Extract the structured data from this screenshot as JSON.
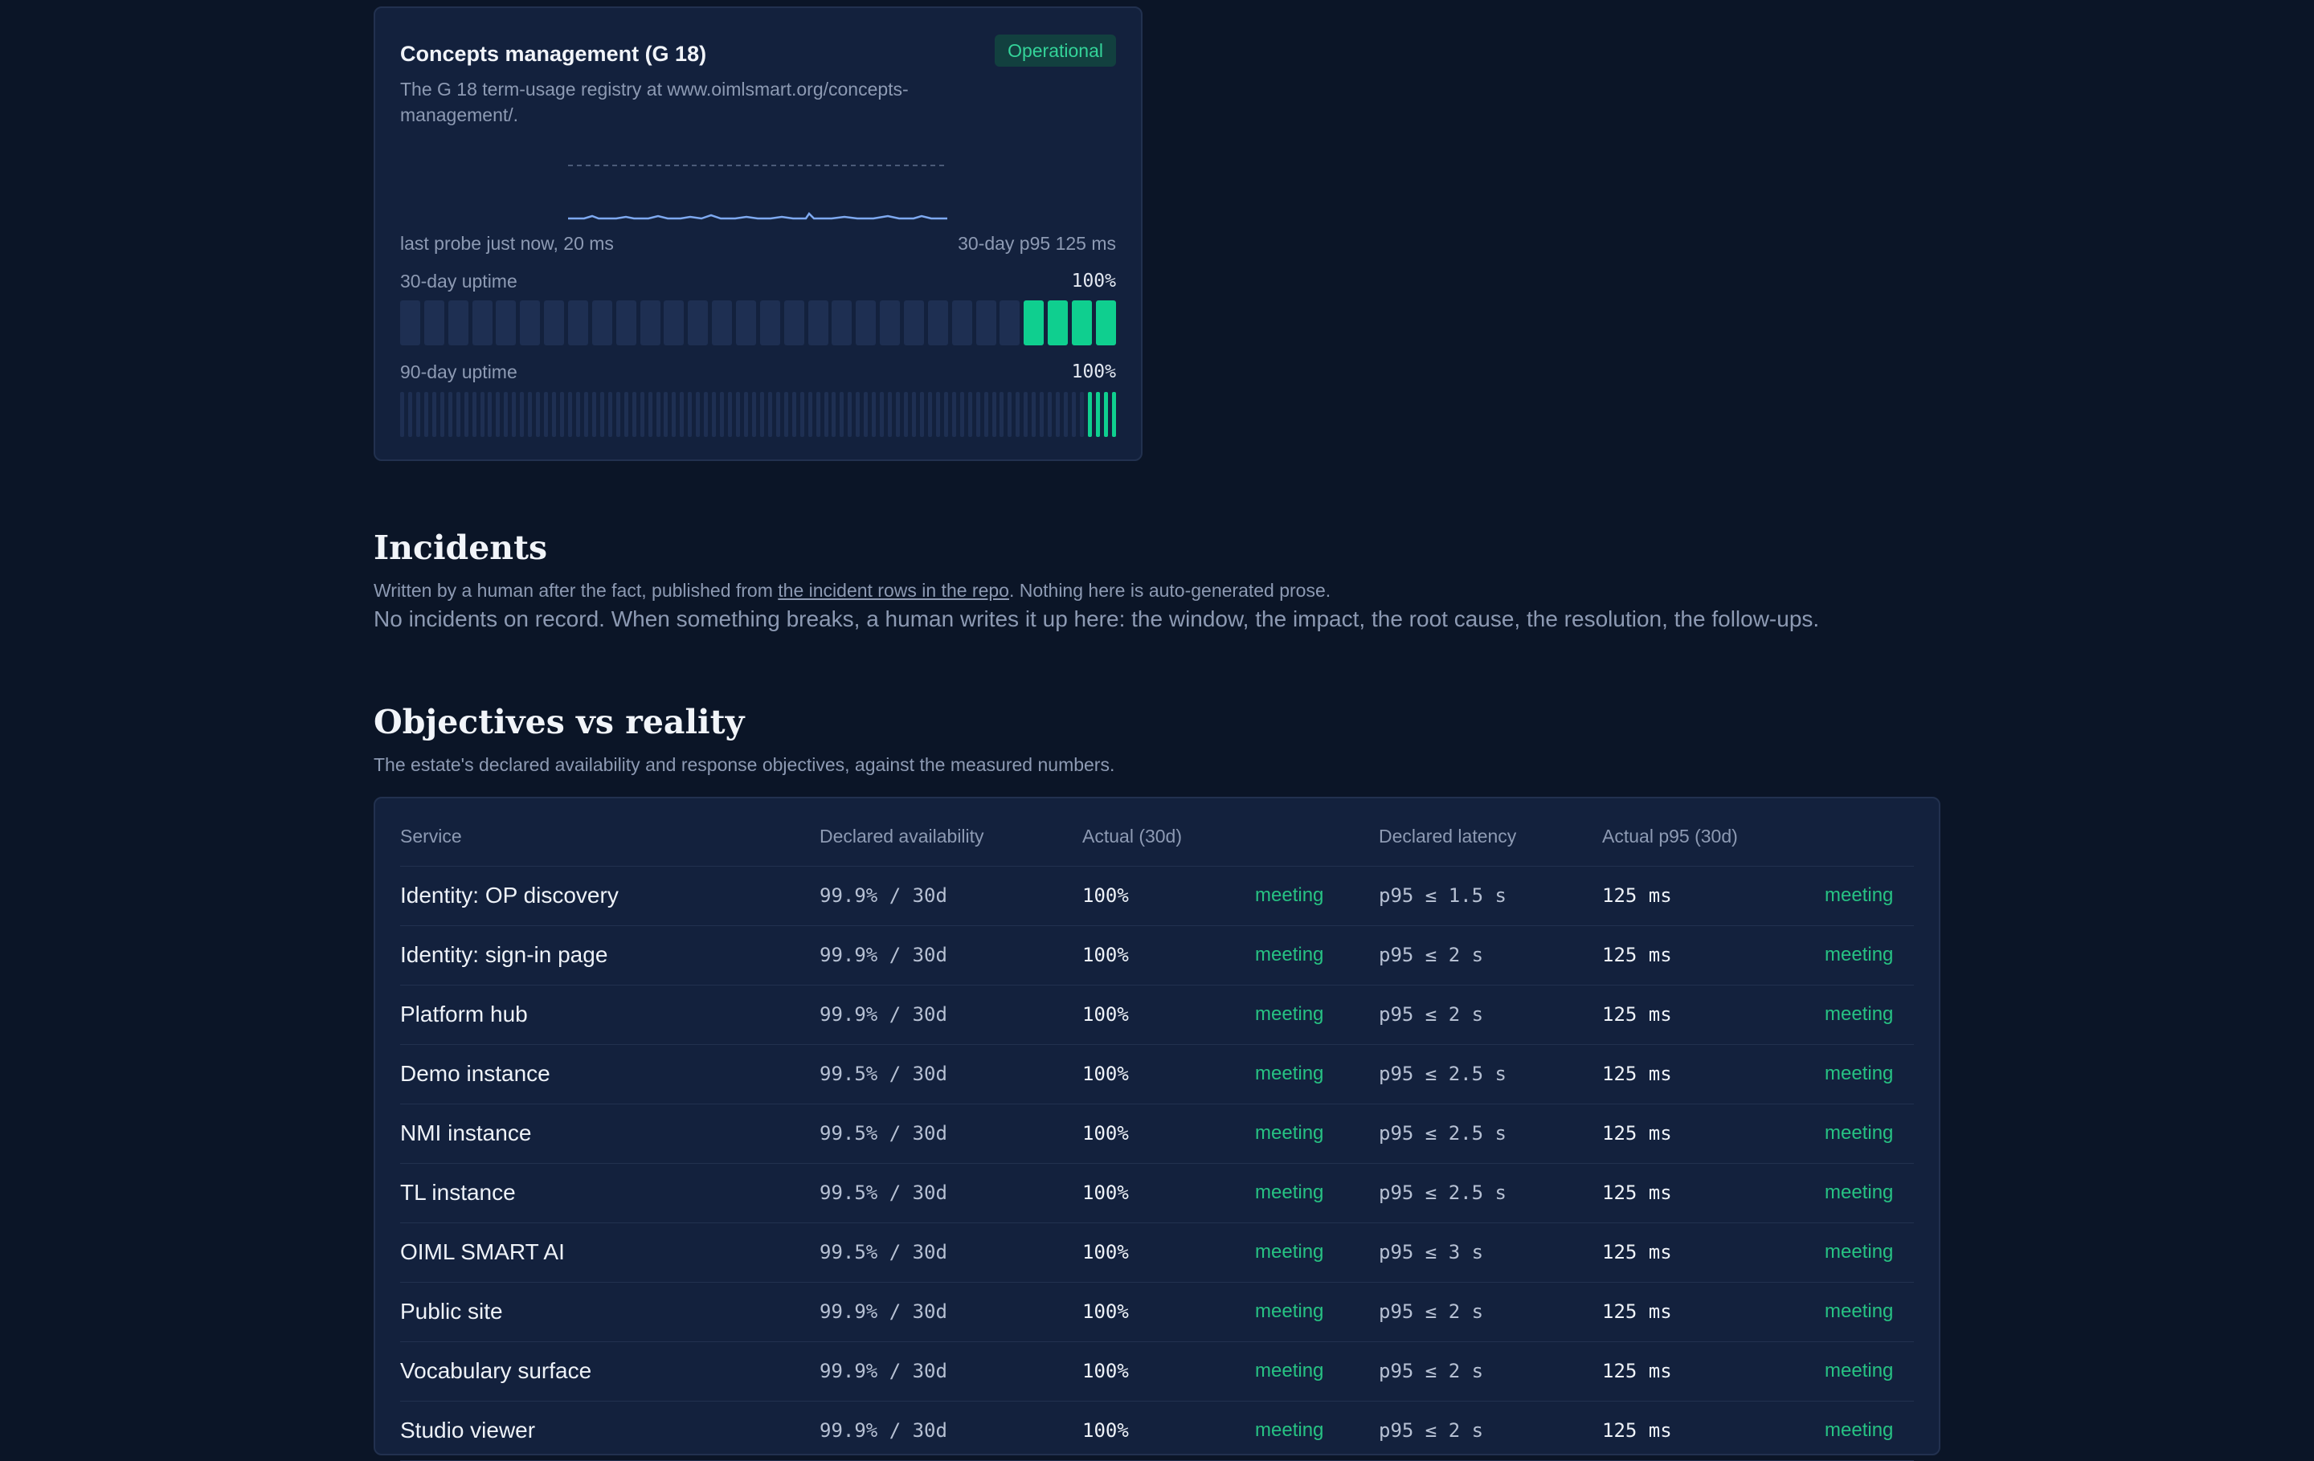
{
  "service_card": {
    "title": "Concepts management (G 18)",
    "status": "Operational",
    "description": "The G 18 term-usage registry at www.oimlsmart.org/concepts-management/.",
    "last_probe": "last probe just now, 20 ms",
    "p95": "30-day p95 125 ms",
    "uptime_30_label": "30-day uptime",
    "uptime_30_value": "100%",
    "uptime_90_label": "90-day uptime",
    "uptime_90_value": "100%",
    "bars_30_total": 30,
    "bars_30_up": 4,
    "bars_90_total": 90,
    "bars_90_up": 4,
    "colors": {
      "up": "#0fcf8f",
      "nodata": "#1e2f52",
      "accent": "#34d399"
    }
  },
  "incidents": {
    "title": "Incidents",
    "subtitle_pre": "Written by a human after the fact, published from ",
    "subtitle_link": "the incident rows in the repo",
    "subtitle_post": ". Nothing here is auto-generated prose.",
    "empty": "No incidents on record. When something breaks, a human writes it up here: the window, the impact, the root cause, the resolution, the follow-ups."
  },
  "objectives": {
    "title": "Objectives vs reality",
    "subtitle": "The estate's declared availability and response objectives, against the measured numbers.",
    "columns": [
      "Service",
      "Declared availability",
      "Actual (30d)",
      "Declared latency",
      "Actual p95 (30d)"
    ],
    "rows": [
      {
        "service": "Identity: OP discovery",
        "declared": "99.9% / 30d",
        "actual": "100%",
        "avail_status": "meeting",
        "latency": "p95 ≤ 1.5 s",
        "p95": "125 ms",
        "lat_status": "meeting"
      },
      {
        "service": "Identity: sign-in page",
        "declared": "99.9% / 30d",
        "actual": "100%",
        "avail_status": "meeting",
        "latency": "p95 ≤ 2 s",
        "p95": "125 ms",
        "lat_status": "meeting"
      },
      {
        "service": "Platform hub",
        "declared": "99.9% / 30d",
        "actual": "100%",
        "avail_status": "meeting",
        "latency": "p95 ≤ 2 s",
        "p95": "125 ms",
        "lat_status": "meeting"
      },
      {
        "service": "Demo instance",
        "declared": "99.5% / 30d",
        "actual": "100%",
        "avail_status": "meeting",
        "latency": "p95 ≤ 2.5 s",
        "p95": "125 ms",
        "lat_status": "meeting"
      },
      {
        "service": "NMI instance",
        "declared": "99.5% / 30d",
        "actual": "100%",
        "avail_status": "meeting",
        "latency": "p95 ≤ 2.5 s",
        "p95": "125 ms",
        "lat_status": "meeting"
      },
      {
        "service": "TL instance",
        "declared": "99.5% / 30d",
        "actual": "100%",
        "avail_status": "meeting",
        "latency": "p95 ≤ 2.5 s",
        "p95": "125 ms",
        "lat_status": "meeting"
      },
      {
        "service": "OIML SMART AI",
        "declared": "99.5% / 30d",
        "actual": "100%",
        "avail_status": "meeting",
        "latency": "p95 ≤ 3 s",
        "p95": "125 ms",
        "lat_status": "meeting"
      },
      {
        "service": "Public site",
        "declared": "99.9% / 30d",
        "actual": "100%",
        "avail_status": "meeting",
        "latency": "p95 ≤ 2 s",
        "p95": "125 ms",
        "lat_status": "meeting"
      },
      {
        "service": "Vocabulary surface",
        "declared": "99.9% / 30d",
        "actual": "100%",
        "avail_status": "meeting",
        "latency": "p95 ≤ 2 s",
        "p95": "125 ms",
        "lat_status": "meeting"
      },
      {
        "service": "Studio viewer",
        "declared": "99.9% / 30d",
        "actual": "100%",
        "avail_status": "meeting",
        "latency": "p95 ≤ 2 s",
        "p95": "125 ms",
        "lat_status": "meeting"
      }
    ]
  }
}
